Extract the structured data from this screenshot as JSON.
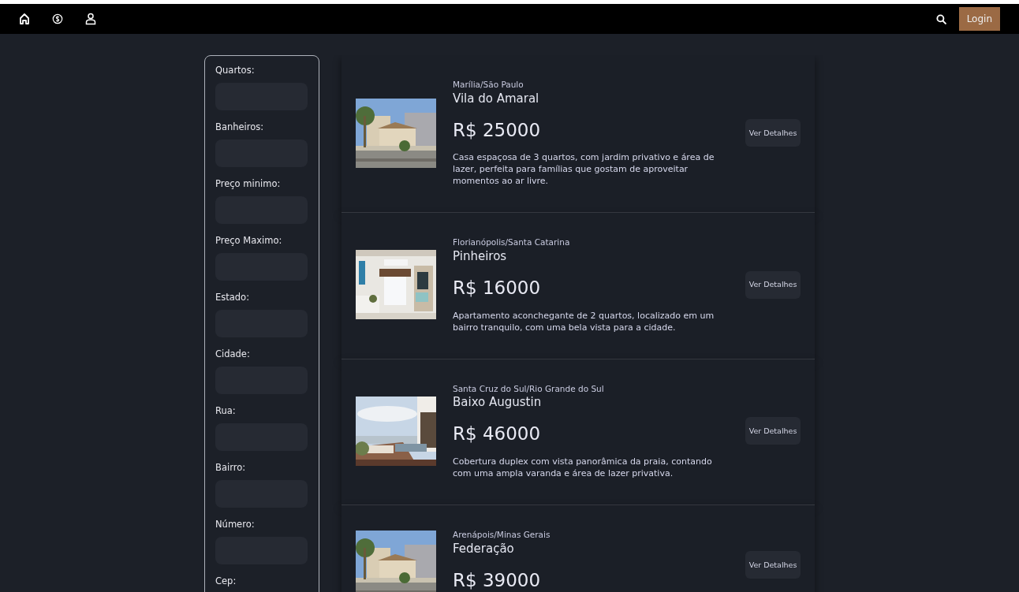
{
  "navbar": {
    "login_button": "Login"
  },
  "filters": [
    {
      "label": "Quartos:"
    },
    {
      "label": "Banheiros:"
    },
    {
      "label": "Preço minimo:"
    },
    {
      "label": "Preço Maximo:"
    },
    {
      "label": "Estado:"
    },
    {
      "label": "Cidade:"
    },
    {
      "label": "Rua:"
    },
    {
      "label": "Bairro:"
    },
    {
      "label": "Número:"
    },
    {
      "label": "Cep:"
    }
  ],
  "listings": [
    {
      "location": "Marília/São Paulo",
      "name": "Vila do Amaral",
      "price": "R$ 25000",
      "description": "Casa espaçosa de 3 quartos, com jardim privativo e área de lazer, perfeita para famílias que gostam de aproveitar momentos ao ar livre.",
      "button": "Ver Detalhes"
    },
    {
      "location": "Florianópolis/Santa Catarina",
      "name": "Pinheiros",
      "price": "R$ 16000",
      "description": "Apartamento aconchegante de 2 quartos, localizado em um bairro tranquilo, com uma bela vista para a cidade.",
      "button": "Ver Detalhes"
    },
    {
      "location": "Santa Cruz do Sul/Rio Grande do Sul",
      "name": "Baixo Augustin",
      "price": "R$ 46000",
      "description": "Cobertura duplex com vista panorâmica da praia, contando com uma ampla varanda e área de lazer privativa.",
      "button": "Ver Detalhes"
    },
    {
      "location": "Arenápois/Minas Gerais",
      "name": "Federação",
      "price": "R$ 39000",
      "button": "Ver Detalhes"
    }
  ]
}
